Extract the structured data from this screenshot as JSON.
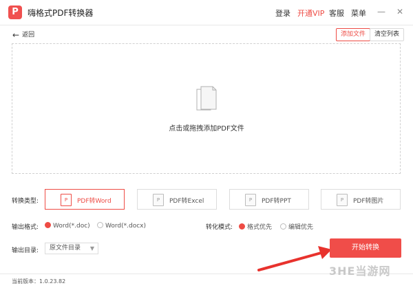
{
  "app": {
    "logo_letter": "P",
    "title": "嗨格式PDF转换器"
  },
  "topnav": {
    "login": "登录",
    "vip": "开通VIP",
    "service": "客服",
    "menu": "菜单"
  },
  "window": {
    "minimize": "—",
    "close": "✕"
  },
  "toolbar": {
    "back_label": "返回",
    "add_file": "添加文件",
    "clear_list": "清空列表"
  },
  "dropzone": {
    "hint": "点击或拖拽添加PDF文件"
  },
  "convert_type": {
    "label": "转换类型:",
    "options": [
      {
        "label": "PDF转Word",
        "icon": "P",
        "active": true
      },
      {
        "label": "PDF转Excel",
        "icon": "P",
        "active": false
      },
      {
        "label": "PDF转PPT",
        "icon": "P",
        "active": false
      },
      {
        "label": "PDF转图片",
        "icon": "P",
        "active": false
      }
    ]
  },
  "output_format": {
    "label": "输出格式:",
    "options": [
      {
        "label": "Word(*.doc)",
        "selected": true
      },
      {
        "label": "Word(*.docx)",
        "selected": false
      }
    ]
  },
  "convert_mode": {
    "label": "转化模式:",
    "options": [
      {
        "label": "格式优先",
        "selected": true
      },
      {
        "label": "编辑优先",
        "selected": false
      }
    ]
  },
  "output_dir": {
    "label": "输出目录:",
    "value": "原文件目录"
  },
  "start_button": "开始转换",
  "status": {
    "version": "当前版本：1.0.23.82"
  },
  "watermark": "3HE当游网",
  "colors": {
    "accent": "#ee4b44",
    "start_button": "#f04d49"
  }
}
